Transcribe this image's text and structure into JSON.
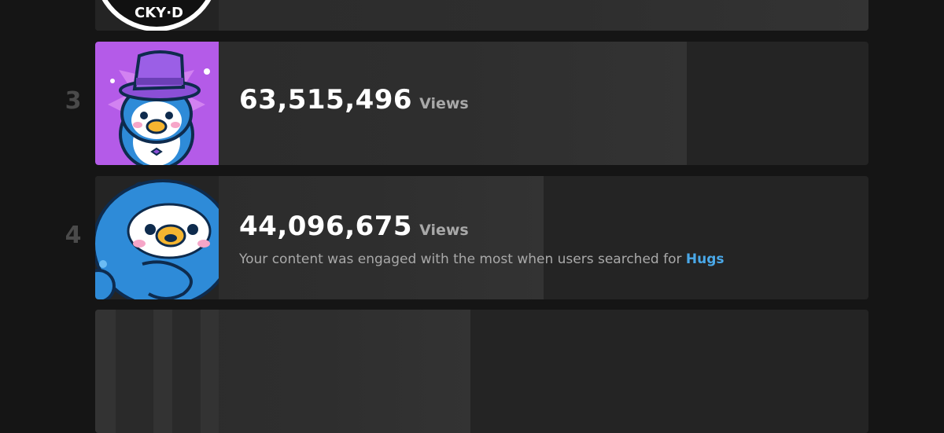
{
  "rows": [
    {
      "rank": "",
      "views": "",
      "views_label": "",
      "bar_fraction": 1.0,
      "avatar": "sticker-badge-icon",
      "avatar_text": "CKY·D"
    },
    {
      "rank": "3",
      "views": "63,515,496",
      "views_label": "Views",
      "bar_fraction": 0.765,
      "avatar": "penguin-top-hat-icon"
    },
    {
      "rank": "4",
      "views": "44,096,675",
      "views_label": "Views",
      "bar_fraction": 0.58,
      "avatar": "penguin-blue-icon",
      "engagement_prefix": "Your content was engaged with the most when users searched for ",
      "engagement_term": "Hugs"
    },
    {
      "rank": "",
      "views": "",
      "views_label": "",
      "bar_fraction": 0.485,
      "avatar": "penguin-partial-icon"
    }
  ],
  "colors": {
    "background": "#151515",
    "row": "#242424",
    "bar": "#2e2e2e",
    "rank": "#4a4a4a",
    "link": "#4aa8e8"
  }
}
